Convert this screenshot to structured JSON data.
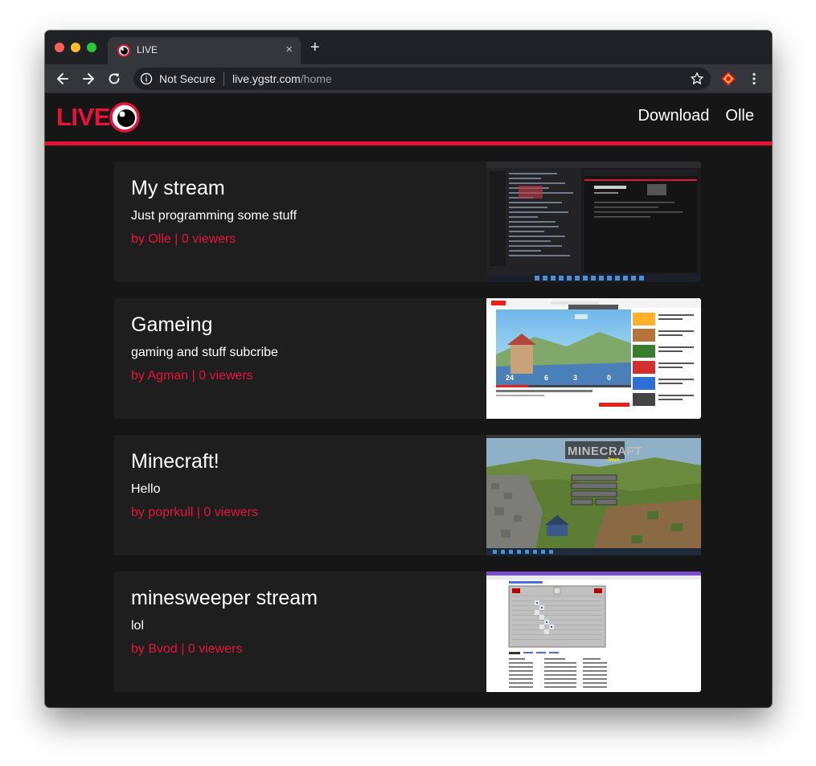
{
  "browser": {
    "tab_title": "LIVE",
    "tab_close": "×",
    "new_tab": "+",
    "not_secure": "Not Secure",
    "url_host": "live.ygstr.com",
    "url_path": "/home"
  },
  "site": {
    "logo_text": "LIVE",
    "accent_color": "#e8133c",
    "nav": {
      "download": "Download",
      "user": "Olle"
    }
  },
  "streams": [
    {
      "title": "My stream",
      "description": "Just programming some stuff",
      "meta": "by Olle | 0 viewers",
      "thumbnail": "code-editor-screenshot"
    },
    {
      "title": "Gameing",
      "description": "gaming and stuff subcribe",
      "meta": "by Agman | 0 viewers",
      "thumbnail": "smash-bros-youtube-screenshot"
    },
    {
      "title": "Minecraft!",
      "description": "Hello",
      "meta": "by poprkull | 0 viewers",
      "thumbnail": "minecraft-title-screen"
    },
    {
      "title": "minesweeper stream",
      "description": "lol",
      "meta": "by Bvod | 0 viewers",
      "thumbnail": "minesweeper-screenshot"
    }
  ]
}
